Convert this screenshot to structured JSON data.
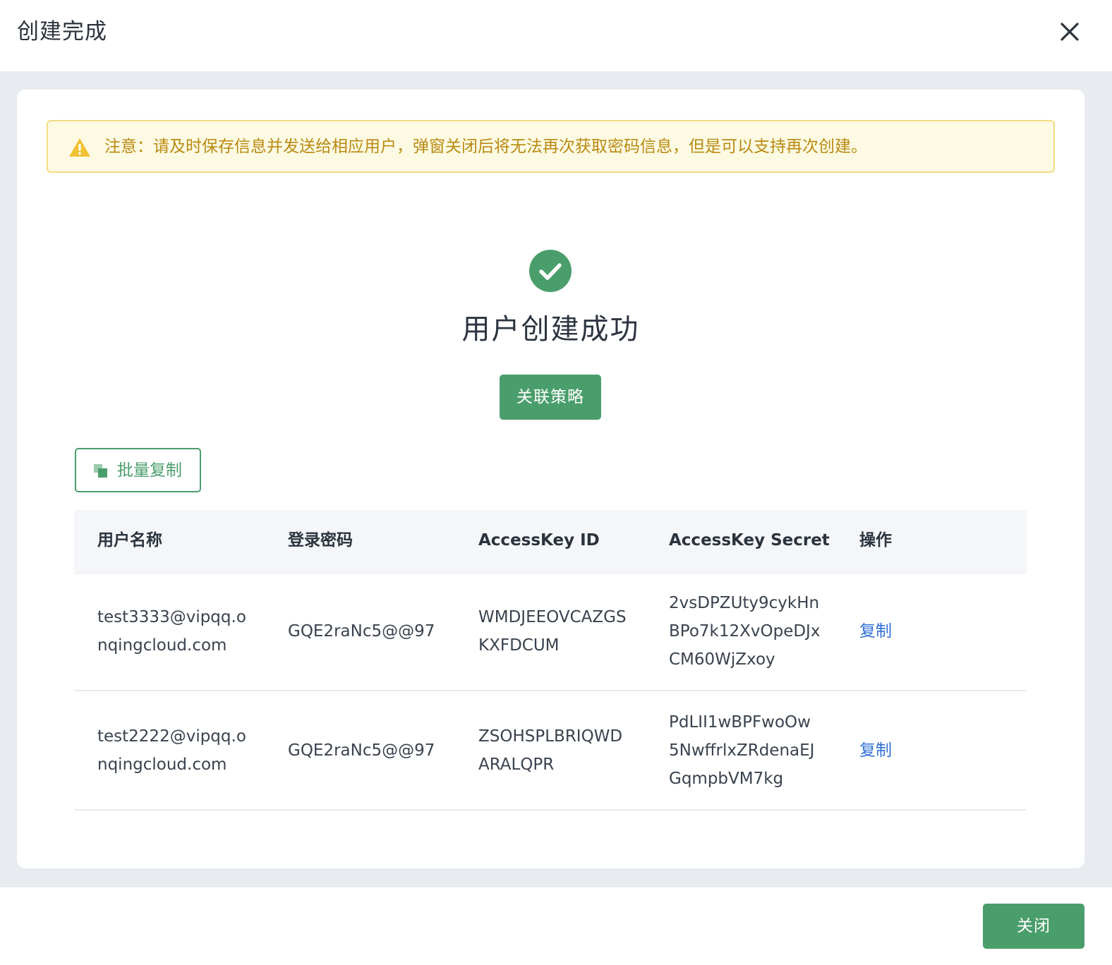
{
  "dialog": {
    "title": "创建完成",
    "close_icon": "close-icon"
  },
  "notice": {
    "icon": "warning-triangle-icon",
    "text": "注意：请及时保存信息并发送给相应用户，弹窗关闭后将无法再次获取密码信息，但是可以支持再次创建。"
  },
  "success": {
    "icon": "check-circle-icon",
    "title": "用户创建成功",
    "button_label": "关联策略"
  },
  "batch_copy": {
    "icon": "copy-icon",
    "label": "批量复制"
  },
  "table": {
    "headers": [
      "用户名称",
      "登录密码",
      "AccessKey ID",
      "AccessKey Secret",
      "操作"
    ],
    "rows": [
      {
        "username_lines": [
          "test3333@vipqq.o",
          "nqingcloud.com"
        ],
        "password": "GQE2raNc5@@97",
        "access_key_id_lines": [
          "WMDJEEOVCAZGS",
          "KXFDCUM"
        ],
        "access_key_secret_lines": [
          "2vsDPZUty9cykHn",
          "BPo7k12XvOpeDJx",
          "CM60WjZxoy"
        ],
        "action": "复制"
      },
      {
        "username_lines": [
          "test2222@vipqq.o",
          "nqingcloud.com"
        ],
        "password": "GQE2raNc5@@97",
        "access_key_id_lines": [
          "ZSOHSPLBRIQWD",
          "ARALQPR"
        ],
        "access_key_secret_lines": [
          "PdLII1wBPFwoOw",
          "5NwffrlxZRdenaEJ",
          "GqmpbVM7kg"
        ],
        "action": "复制"
      }
    ]
  },
  "footer": {
    "close_label": "关闭"
  },
  "colors": {
    "primary_green": "#4a9e6b",
    "link_blue": "#2f6fd6",
    "warning_text": "#b98a12",
    "warning_bg": "#fdfae3",
    "warning_border": "#f3dc83",
    "body_bg": "#e8ecf1"
  }
}
